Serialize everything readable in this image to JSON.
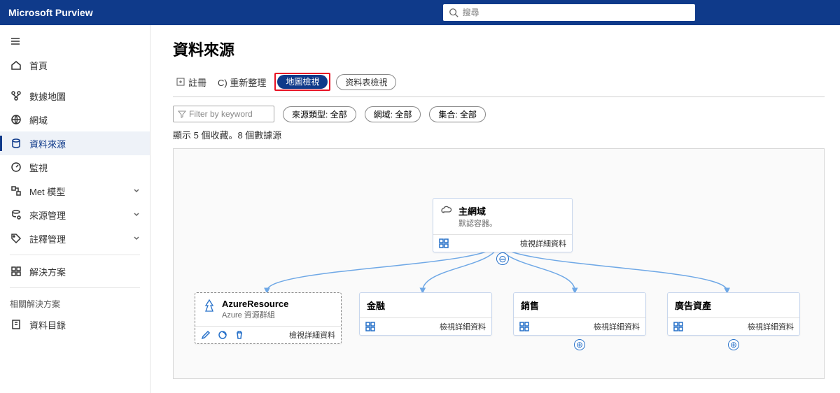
{
  "header": {
    "brand": "Microsoft Purview",
    "search_placeholder": "搜尋"
  },
  "sidebar": {
    "items": [
      {
        "label": "首頁"
      },
      {
        "label": "數據地圖"
      },
      {
        "label": "網域"
      },
      {
        "label": "資料來源"
      },
      {
        "label": "監視"
      },
      {
        "label": "Met 模型"
      },
      {
        "label": "來源管理"
      },
      {
        "label": "註釋管理"
      },
      {
        "label": "解決方案"
      }
    ],
    "related_heading": "相關解決方案",
    "related": {
      "label": "資料目錄"
    }
  },
  "page": {
    "title": "資料來源",
    "toolbar": {
      "register": "註冊",
      "refresh": "C) 重新整理",
      "map_view": "地圖檢視",
      "table_view": "资料表檢視"
    },
    "filters": {
      "keyword_placeholder": "Filter by keyword",
      "source_type": "來源類型: 全部",
      "domain": "網域: 全部",
      "collection": "集合: 全部"
    },
    "count_text": "顯示 5 個收藏。8 個數據源"
  },
  "nodes": {
    "root": {
      "title": "主網域",
      "subtitle": "默認容器。",
      "link": "檢視詳細資料"
    },
    "azure": {
      "title": "AzureResource",
      "subtitle": "Azure 資源群組",
      "link": "檢視詳細資料"
    },
    "child1": {
      "title": "金融",
      "link": "檢視詳細資料"
    },
    "child2": {
      "title": "銷售",
      "link": "檢視詳細資料"
    },
    "child3": {
      "title": "廣告資產",
      "link": "檢視詳細資料"
    }
  }
}
